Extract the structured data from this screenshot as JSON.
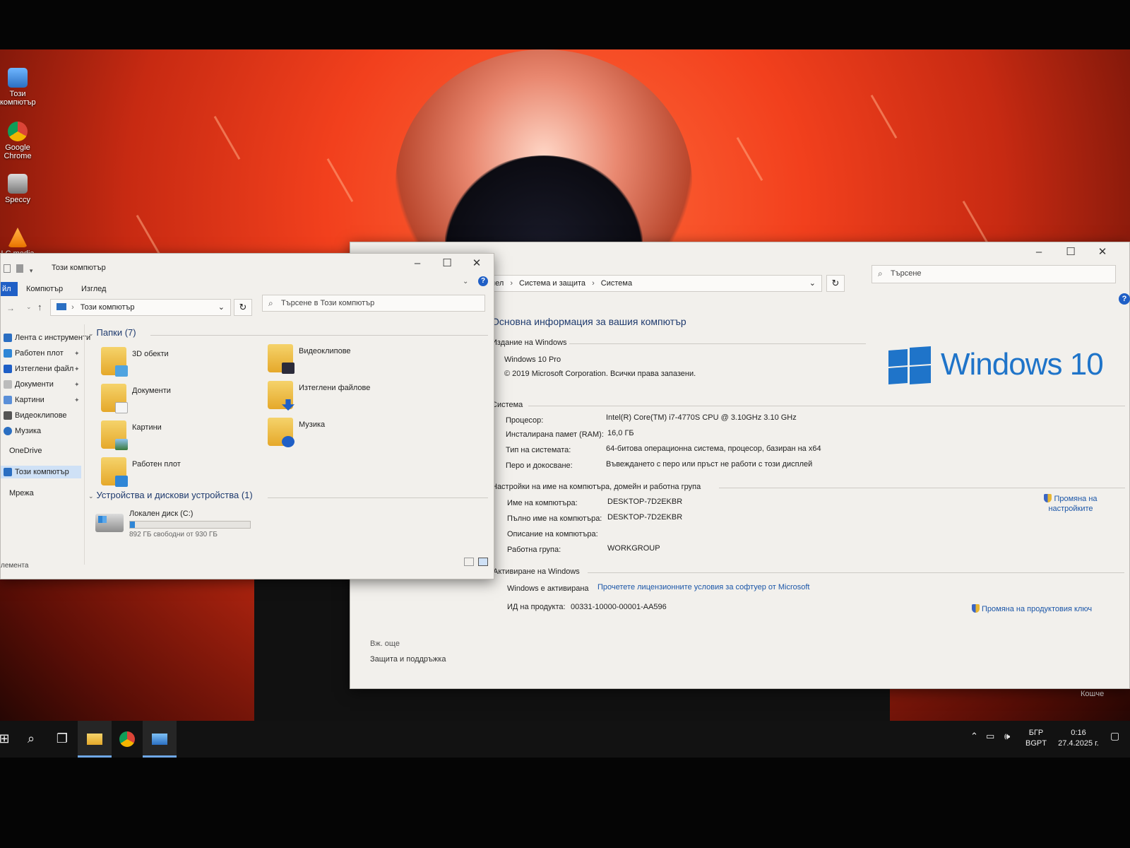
{
  "desktop": {
    "icons": [
      {
        "label": "Този компютър",
        "icon": "computer-icon"
      },
      {
        "label": "Google Chrome",
        "icon": "chrome-icon"
      },
      {
        "label": "Speccy",
        "icon": "speccy-icon"
      },
      {
        "label": "LC media",
        "icon": "vlc-icon"
      }
    ],
    "recycle_label": "Кошче"
  },
  "explorer": {
    "title": "Този компютър",
    "ribbon_tabs": [
      "йл",
      "Компютър",
      "Изглед"
    ],
    "address": "Този компютър",
    "search_placeholder": "Търсене в Този компютър",
    "nav_items": [
      {
        "label": "Лента с инструменти",
        "pinned": false
      },
      {
        "label": "Работен плот",
        "pinned": true
      },
      {
        "label": "Изтеглени файл",
        "pinned": true
      },
      {
        "label": "Документи",
        "pinned": true
      },
      {
        "label": "Картини",
        "pinned": true
      },
      {
        "label": "Видеоклипове",
        "pinned": false
      },
      {
        "label": "Музика",
        "pinned": false
      },
      {
        "label": "OneDrive",
        "pinned": false
      },
      {
        "label": "Този компютър",
        "pinned": false
      },
      {
        "label": "Мрежа",
        "pinned": false
      }
    ],
    "folders_header": "Папки (7)",
    "folders": [
      {
        "label": "3D обекти",
        "icon": "3d-objects-icon"
      },
      {
        "label": "Видеоклипове",
        "icon": "videos-icon"
      },
      {
        "label": "Документи",
        "icon": "documents-icon"
      },
      {
        "label": "Изтеглени файлове",
        "icon": "downloads-icon"
      },
      {
        "label": "Картини",
        "icon": "pictures-icon"
      },
      {
        "label": "Музика",
        "icon": "music-icon"
      },
      {
        "label": "Работен плот",
        "icon": "desktop-folder-icon"
      }
    ],
    "devices_header": "Устройства и дискови устройства (1)",
    "drive": {
      "label": "Локален диск (C:)",
      "free_text": "892 ГБ свободни от 930 ГБ",
      "used_fraction": 0.041
    },
    "status_text": "лемента"
  },
  "system": {
    "breadcrumb": [
      "нел",
      "Система и защита",
      "Система"
    ],
    "search_placeholder": "Търсене",
    "heading": "Основна информация за вашия компютър",
    "edition_group": "Издание на Windows",
    "edition": "Windows 10 Pro",
    "copyright": "© 2019 Microsoft Corporation. Всички права запазени.",
    "logo_text": "Windows 10",
    "system_group": "Система",
    "system_rows": [
      {
        "label": "Процесор:",
        "value": "Intel(R) Core(TM) i7-4770S CPU @ 3.10GHz   3.10 GHz"
      },
      {
        "label": "Инсталирана памет (RAM):",
        "value": "16,0 ГБ"
      },
      {
        "label": "Тип на системата:",
        "value": "64-битова операционна система, процесор, базиран на x64"
      },
      {
        "label": "Перо и докосване:",
        "value": "Въвеждането с перо или пръст не работи с този дисплей"
      }
    ],
    "name_group": "Настройки на име на компютъра, домейн и работна група",
    "name_rows": [
      {
        "label": "Име на компютъра:",
        "value": "DESKTOP-7D2EKBR"
      },
      {
        "label": "Пълно име на компютъра:",
        "value": "DESKTOP-7D2EKBR"
      },
      {
        "label": "Описание на компютъра:",
        "value": ""
      },
      {
        "label": "Работна група:",
        "value": "WORKGROUP"
      }
    ],
    "change_settings": "Промяна на настройките",
    "activation_group": "Активиране на Windows",
    "activated_text": "Windows е активирана",
    "license_link": "Прочетете лицензионните условия за софтуер от Microsoft",
    "product_id_label": "ИД на продукта:",
    "product_id": "00331-10000-00001-AA596",
    "change_key": "Промяна на продуктовия ключ",
    "see_also": "Вж. още",
    "security_link": "Защита и поддръжка"
  },
  "taskbar": {
    "lang_top": "БГР",
    "lang_bottom": "BGPT",
    "time": "0:16",
    "date": "27.4.2025 г."
  },
  "colors": {
    "accent": "#1b56a8",
    "windows_blue": "#1f74c9",
    "wallpaper_red": "#f2401d"
  }
}
